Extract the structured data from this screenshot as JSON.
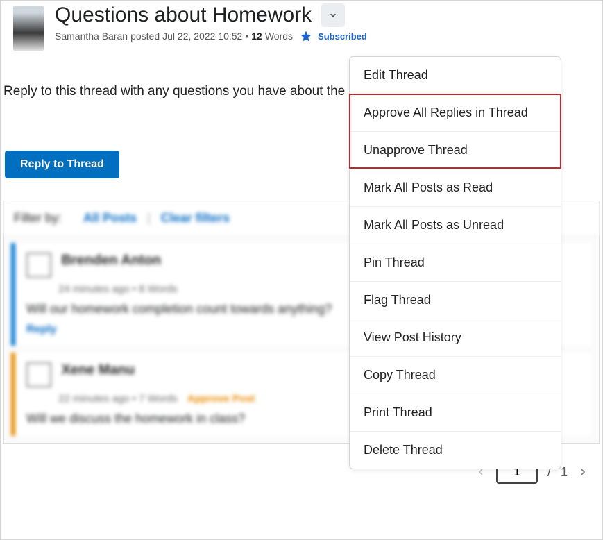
{
  "thread": {
    "title": "Questions about Homework",
    "author": "Samantha Baran",
    "posted_label": "posted",
    "posted_at": "Jul 22, 2022 10:52",
    "bullet": "•",
    "word_count": "12",
    "words_label": "Words",
    "subscribed_label": "Subscribed",
    "body": "Reply to this thread with any questions you have about the homework.",
    "reply_button": "Reply to Thread"
  },
  "menu": {
    "items": [
      "Edit Thread",
      "Approve All Replies in Thread",
      "Unapprove Thread",
      "Mark All Posts as Read",
      "Mark All Posts as Unread",
      "Pin Thread",
      "Flag Thread",
      "View Post History",
      "Copy Thread",
      "Print Thread",
      "Delete Thread"
    ]
  },
  "filters": {
    "label": "Filter by:",
    "all_posts": "All Posts",
    "clear": "Clear filters"
  },
  "replies": [
    {
      "name": "Brenden Anton",
      "meta": "24 minutes ago • 8 Words",
      "body": "Will our homework completion count towards anything?",
      "reply_label": "Reply"
    },
    {
      "name": "Xene Manu",
      "meta": "22 minutes ago • 7 Words",
      "approve_label": "Approve Post",
      "body": "Will we discuss the homework in class?"
    }
  ],
  "pager": {
    "current": "1",
    "sep": "/",
    "total": "1"
  }
}
